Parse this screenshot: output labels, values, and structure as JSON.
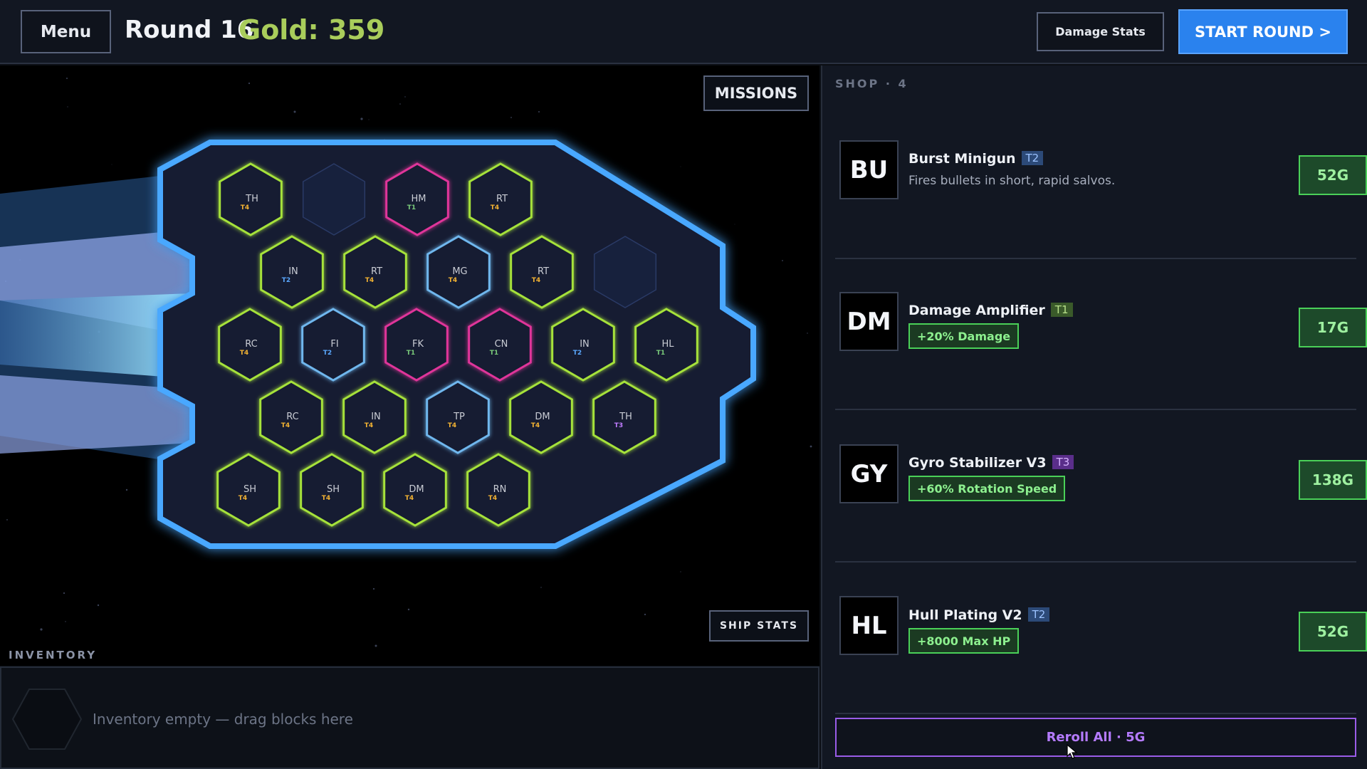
{
  "header": {
    "menu_label": "Menu",
    "round_label": "Round 16",
    "gold_label": "Gold: 359",
    "damage_stats_label": "Damage Stats",
    "start_round_label": "START ROUND >"
  },
  "game": {
    "missions_label": "MISSIONS",
    "ship_stats_label": "SHIP STATS"
  },
  "ship": {
    "grid": [
      [
        {
          "code": "TH",
          "tier": "T4",
          "border": "green"
        },
        {
          "code": "",
          "tier": "",
          "border": "empty"
        },
        {
          "code": "HM",
          "tier": "T1",
          "border": "pink"
        },
        {
          "code": "RT",
          "tier": "T4",
          "border": "green"
        }
      ],
      [
        {
          "code": "IN",
          "tier": "T2",
          "border": "green"
        },
        {
          "code": "RT",
          "tier": "T4",
          "border": "green"
        },
        {
          "code": "MG",
          "tier": "T4",
          "border": "blue"
        },
        {
          "code": "RT",
          "tier": "T4",
          "border": "green"
        },
        {
          "code": "",
          "tier": "",
          "border": "empty"
        }
      ],
      [
        {
          "code": "RC",
          "tier": "T4",
          "border": "green"
        },
        {
          "code": "FI",
          "tier": "T2",
          "border": "blue"
        },
        {
          "code": "FK",
          "tier": "T1",
          "border": "pink"
        },
        {
          "code": "CN",
          "tier": "T1",
          "border": "pink"
        },
        {
          "code": "IN",
          "tier": "T2",
          "border": "green"
        },
        {
          "code": "HL",
          "tier": "T1",
          "border": "green"
        }
      ],
      [
        {
          "code": "RC",
          "tier": "T4",
          "border": "green"
        },
        {
          "code": "IN",
          "tier": "T4",
          "border": "green"
        },
        {
          "code": "TP",
          "tier": "T4",
          "border": "blue"
        },
        {
          "code": "DM",
          "tier": "T4",
          "border": "green"
        },
        {
          "code": "TH",
          "tier": "T3",
          "border": "green"
        }
      ],
      [
        {
          "code": "SH",
          "tier": "T4",
          "border": "green"
        },
        {
          "code": "SH",
          "tier": "T4",
          "border": "green"
        },
        {
          "code": "DM",
          "tier": "T4",
          "border": "green"
        },
        {
          "code": "RN",
          "tier": "T4",
          "border": "green"
        }
      ]
    ],
    "colors": {
      "green": "#a6e23a",
      "pink": "#e0359a",
      "blue": "#6fb7ee",
      "empty": "#2a3a66",
      "hull_glow": "#3aa0ff",
      "hull_fill": "#121b33",
      "tier_T1": "#79c97a",
      "tier_T2": "#5aa8ff",
      "tier_T3": "#c07cff",
      "tier_T4": "#f2b233"
    }
  },
  "inventory": {
    "label": "INVENTORY",
    "empty_text": "Inventory empty — drag blocks here"
  },
  "shop": {
    "label": "SHOP · 4",
    "items": [
      {
        "icon": "BU",
        "name": "Burst Minigun",
        "tier": "T2",
        "description": "Fires bullets in short, rapid salvos.",
        "tag": "",
        "price": "52G"
      },
      {
        "icon": "DM",
        "name": "Damage Amplifier",
        "tier": "T1",
        "description": "",
        "tag": "+20% Damage",
        "price": "17G"
      },
      {
        "icon": "GY",
        "name": "Gyro Stabilizer V3",
        "tier": "T3",
        "description": "",
        "tag": "+60% Rotation Speed",
        "price": "138G"
      },
      {
        "icon": "HL",
        "name": "Hull Plating V2",
        "tier": "T2",
        "description": "",
        "tag": "+8000 Max HP",
        "price": "52G"
      }
    ],
    "reroll_label": "Reroll All · 5G"
  },
  "icons": {
    "cursor": "mouse-pointer-icon",
    "inventory_slot": "hexagon-icon"
  }
}
